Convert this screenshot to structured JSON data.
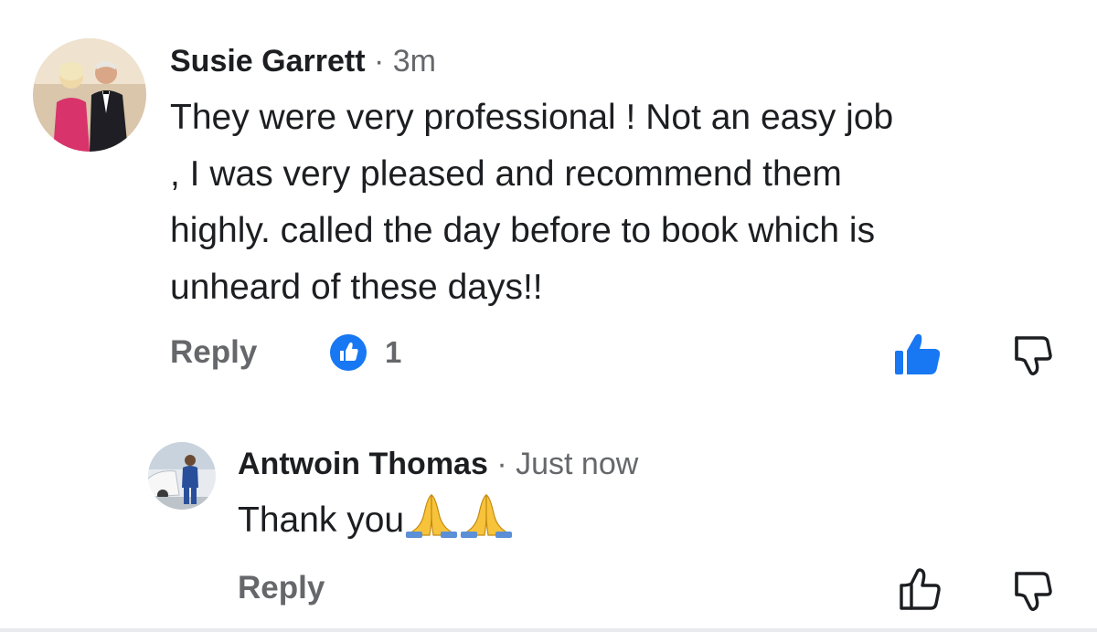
{
  "comments": [
    {
      "author": "Susie Garrett",
      "separator": "·",
      "time": "3m",
      "lines": [
        "They were very professional ! Not an easy job",
        ", I was very pleased and recommend them",
        "highly. called the day before to book which is",
        "unheard of these days!!"
      ],
      "reply_label": "Reply",
      "like_count": "1",
      "liked": true,
      "icons": [
        "avatar-couple",
        "like-badge-icon",
        "thumbs-up-filled-icon",
        "thumbs-down-outline-icon"
      ]
    },
    {
      "author": "Antwoin Thomas",
      "separator": "·",
      "time": "Just now",
      "text": "Thank you",
      "emoji": "🙏🙏",
      "reply_label": "Reply",
      "liked": false,
      "icons": [
        "avatar-man-with-car",
        "thumbs-up-outline-icon",
        "thumbs-down-outline-icon"
      ]
    }
  ],
  "colors": {
    "like_blue": "#1877f2",
    "secondary_text": "#65676b",
    "primary_text": "#1c1e21"
  }
}
